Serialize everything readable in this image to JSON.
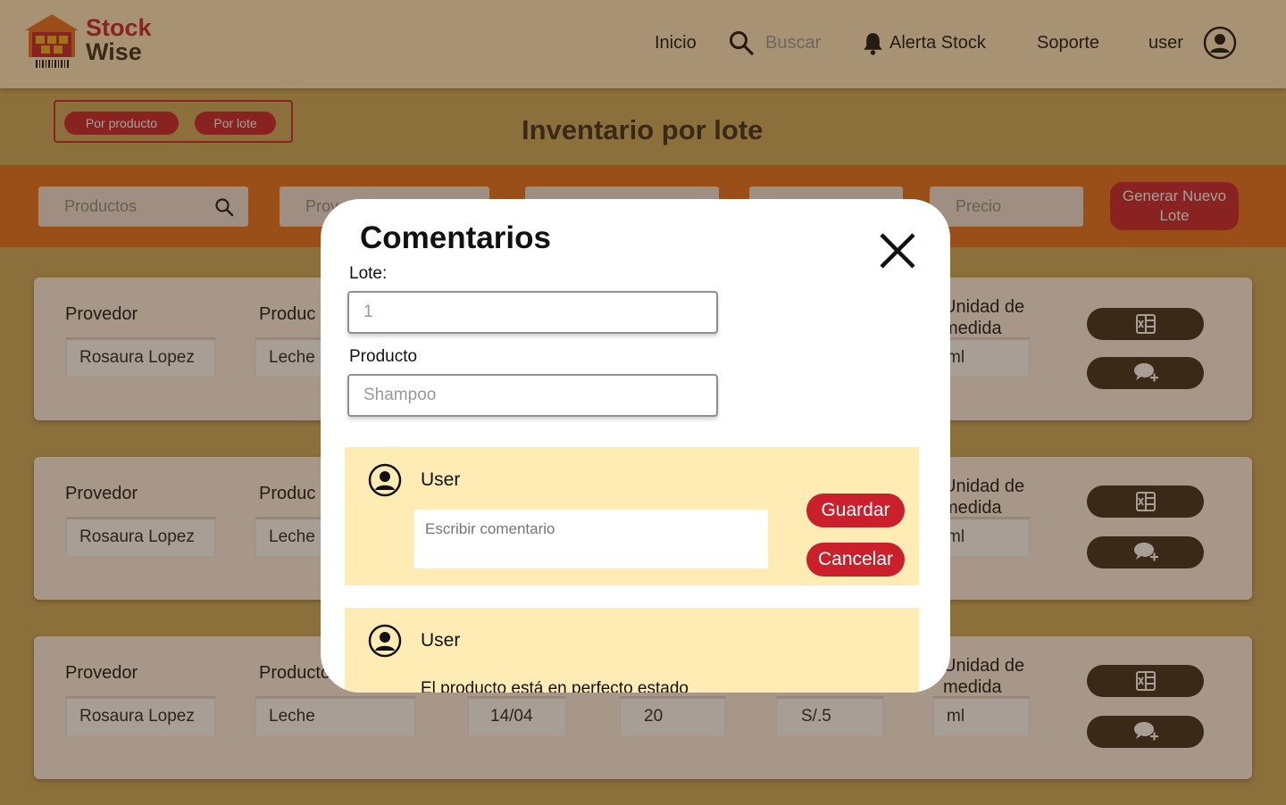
{
  "header": {
    "logo_line1": "Stock",
    "logo_line2": "Wise",
    "nav_inicio": "Inicio",
    "search_placeholder": "Buscar",
    "nav_alerta": "Alerta Stock",
    "nav_soporte": "Soporte",
    "nav_user": "user"
  },
  "toggle": {
    "by_product": "Por producto",
    "by_lot": "Por lote"
  },
  "page_title": "Inventario por lote",
  "filters": {
    "productos": "Productos",
    "proveedor": "Prov",
    "precio": "Precio",
    "generate_button": "Generar Nuevo Lote"
  },
  "cards": [
    {
      "provider_label": "Provedor",
      "product_label": "Produc",
      "unit_label": "Unidad de medida",
      "provider": "Rosaura Lopez",
      "product": "Leche",
      "unit": "ml"
    },
    {
      "provider_label": "Provedor",
      "product_label": "Produc",
      "unit_label": "Unidad de medida",
      "provider": "Rosaura Lopez",
      "product": "Leche",
      "unit": "ml"
    },
    {
      "provider_label": "Provedor",
      "product_label": "Producto",
      "unit_label": "Unidad de medida",
      "provider": "Rosaura Lopez",
      "product": "Leche",
      "date": "14/04",
      "quantity": "20",
      "price": "S/.5",
      "unit": "ml"
    }
  ],
  "modal": {
    "title": "Comentarios",
    "lote_label": "Lote:",
    "lote_value": "1",
    "producto_label": "Producto",
    "producto_value": "Shampoo",
    "new_comment": {
      "user": "User",
      "placeholder": "Escribir comentario",
      "save": "Guardar",
      "cancel": "Cancelar"
    },
    "existing_comment": {
      "user": "User",
      "text": "El producto está en perfecto estado"
    }
  },
  "colors": {
    "header_bg": "#ffecc4",
    "brand_red": "#c9202c",
    "dark_brown": "#3a2a18",
    "filter_bar": "#e96f1c",
    "comment_bg": "#ffecb4"
  }
}
